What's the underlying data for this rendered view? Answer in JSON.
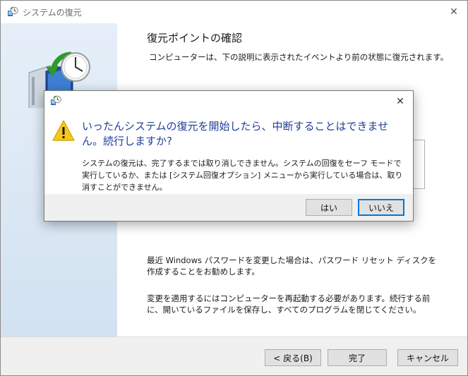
{
  "window": {
    "title": "システムの復元"
  },
  "page": {
    "heading": "復元ポイントの確認",
    "description": "コンピューターは、下の説明に表示されたイベントより前の状態に復元されます。",
    "note_password": "最近 Windows パスワードを変更した場合は、パスワード リセット ディスクを作成することをお勧めします。",
    "note_restart": "変更を適用するにはコンピューターを再起動する必要があります。続行する前に、開いているファイルを保存し、すべてのプログラムを閉じてください。"
  },
  "footer": {
    "back_label": "< 戻る(B)",
    "finish_label": "完了",
    "cancel_label": "キャンセル"
  },
  "dialog": {
    "main_instruction": "いったんシステムの復元を開始したら、中断することはできません。続行しますか?",
    "content": "システムの復元は、完了するまでは取り消しできません。システムの回復をセーフ モードで実行しているか、または [システム回復オプション] メニューから実行している場合は、取り消すことができません。",
    "yes_label": "はい",
    "no_label": "いいえ"
  },
  "icons": {
    "window_icon": "system-restore-icon",
    "hero_icon": "system-restore-clock-icon",
    "warning_icon": "warning-icon",
    "close_icon": "close-icon"
  },
  "colors": {
    "accent": "#0078d7",
    "instruction_text": "#1f3f9a",
    "warning_yellow": "#f7c81a"
  }
}
